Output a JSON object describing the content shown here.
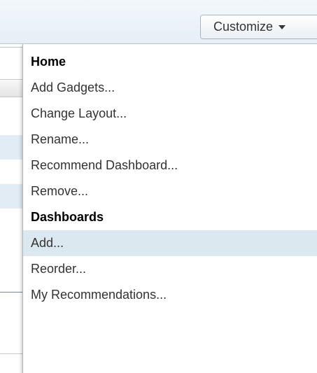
{
  "header": {
    "customize_label": "Customize"
  },
  "menu": {
    "home_heading": "Home",
    "home_items": [
      {
        "label": "Add Gadgets..."
      },
      {
        "label": "Change Layout..."
      },
      {
        "label": "Rename..."
      },
      {
        "label": "Recommend Dashboard..."
      },
      {
        "label": "Remove..."
      }
    ],
    "dashboards_heading": "Dashboards",
    "dashboard_items": [
      {
        "label": "Add...",
        "highlighted": true
      },
      {
        "label": "Reorder..."
      },
      {
        "label": "My Recommendations..."
      }
    ]
  },
  "colors": {
    "header_bg": "#e6eff6",
    "highlight_bg": "#dce8ef",
    "text": "#333333"
  }
}
